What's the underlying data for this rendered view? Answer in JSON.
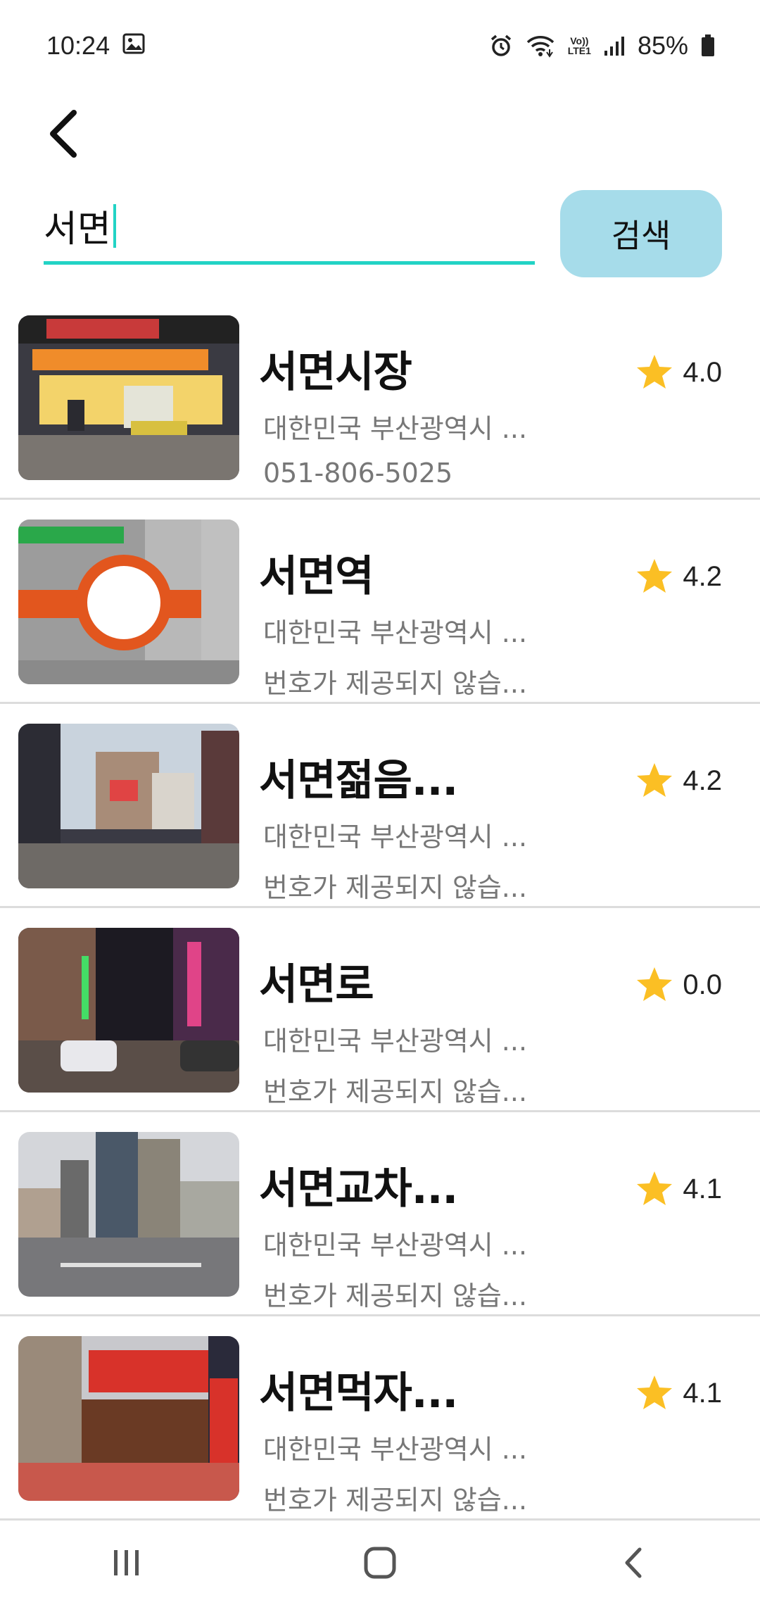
{
  "status_bar": {
    "time": "10:24",
    "battery": "85%",
    "volte_label_top": "Vo))",
    "volte_label_bottom": "LTE1"
  },
  "search": {
    "value": "서면",
    "button_label": "검색"
  },
  "results": [
    {
      "title": "서면시장",
      "address": "대한민국 부산광역시 ...",
      "phone": "051-806-5025",
      "rating": "4.0"
    },
    {
      "title": "서면역",
      "address": "대한민국 부산광역시 ...",
      "phone": "번호가 제공되지 않습...",
      "rating": "4.2"
    },
    {
      "title": "서면젊음...",
      "address": "대한민국 부산광역시 ...",
      "phone": "번호가 제공되지 않습...",
      "rating": "4.2"
    },
    {
      "title": "서면로",
      "address": "대한민국 부산광역시 ...",
      "phone": "번호가 제공되지 않습...",
      "rating": "0.0"
    },
    {
      "title": "서면교차...",
      "address": "대한민국 부산광역시 ...",
      "phone": "번호가 제공되지 않습...",
      "rating": "4.1"
    },
    {
      "title": "서면먹자...",
      "address": "대한민국 부산광역시 ...",
      "phone": "번호가 제공되지 않습...",
      "rating": "4.1"
    }
  ],
  "colors": {
    "accent": "#22d3c5",
    "search_button": "#a6dcea",
    "star": "#fbbf24"
  }
}
